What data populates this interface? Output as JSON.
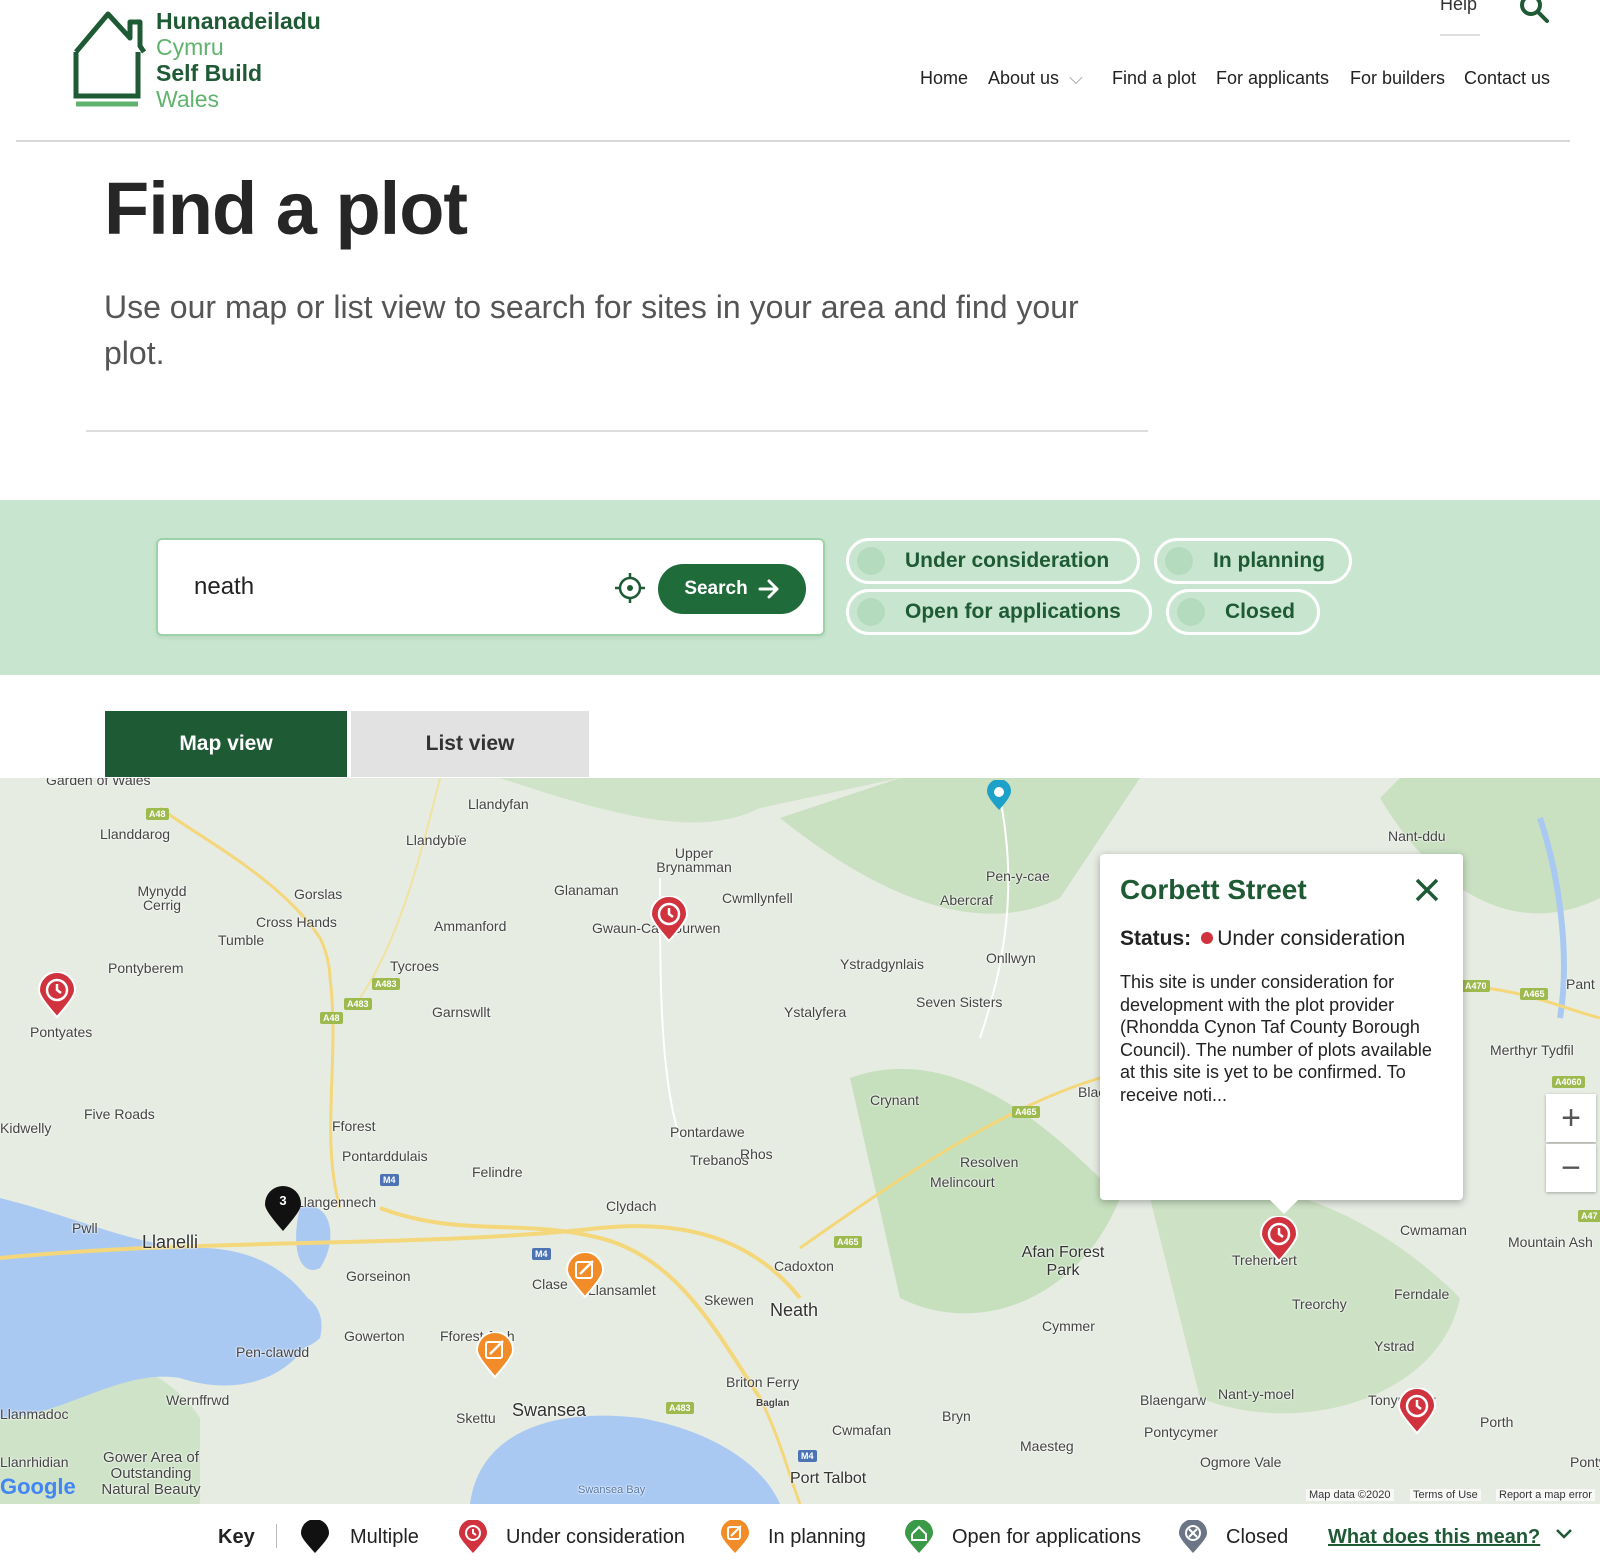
{
  "logo": {
    "line1": "Hunanadeiladu",
    "line2": "Cymru",
    "line3": "Self Build",
    "line4": "Wales"
  },
  "header": {
    "help": "Help",
    "nav": [
      "Home",
      "About us",
      "Find a plot",
      "For applicants",
      "For builders",
      "Contact us"
    ]
  },
  "hero": {
    "title": "Find a plot",
    "lead": "Use our map or list view to search for sites in your area and find your plot."
  },
  "search": {
    "value": "neath",
    "button": "Search",
    "filters": [
      "Under consideration",
      "In planning",
      "Open for applications",
      "Closed"
    ]
  },
  "tabs": {
    "map": "Map view",
    "list": "List view"
  },
  "map": {
    "places": [
      "Garden of Wales",
      "Llandyfan",
      "Llanddarog",
      "Llandybïe",
      "Upper Brynamman",
      "Nant-ddu",
      "Mynydd Cerrig",
      "Gorslas",
      "Glanaman",
      "Cwmllynfell",
      "Pen-y-cae",
      "Cross Hands",
      "Abercraf",
      "Tumble",
      "Ammanford",
      "Gwaun-Cae-Gurwen",
      "Pontyberem",
      "Tycroes",
      "Ystradgynlais",
      "Onllwyn",
      "Garnswllt",
      "Seven Sisters",
      "Ystalyfera",
      "Pontyates",
      "Pant",
      "Merthyr Tydfil",
      "Crynant",
      "Blaengwrach",
      "Five Roads",
      "Fforest",
      "Pontardawe",
      "Kidwelly",
      "Pontarddulais",
      "Trebanos",
      "Rhos",
      "Resolven",
      "Felindre",
      "Melincourt",
      "Llangennech",
      "Clydach",
      "Pwll",
      "Llanelli",
      "Cwmaman",
      "Mountain Ash",
      "Cadoxton",
      "Afan Forest Park",
      "Gorseinon",
      "Clase",
      "Llansamlet",
      "Skewen",
      "Neath",
      "Treherbert",
      "Treorchy",
      "Ferndale",
      "Gowerton",
      "Fforest-fach",
      "Cymmer",
      "Pen-clawdd",
      "Ystrad",
      "Briton Ferry",
      "Wernffrwd",
      "Baglan",
      "Blaengarw",
      "Nant-y-moel",
      "Tonypandy",
      "Skettu",
      "Swansea",
      "Pontycymer",
      "Porth",
      "Cwmafan",
      "Bryn",
      "Maesteg",
      "Llanmadoc",
      "Gower Area of Outstanding Natural Beauty",
      "Port Talbot",
      "Ogmore Vale",
      "Swansea Bay",
      "Llanrhidian",
      "Ponty"
    ],
    "roads": [
      "A48",
      "A483",
      "A483",
      "A48",
      "M4",
      "M4",
      "A465",
      "A465",
      "A483",
      "M4",
      "A470",
      "A465",
      "A4060",
      "A47"
    ],
    "cluster_count": "3",
    "popup": {
      "title": "Corbett Street",
      "status_label": "Status:",
      "status_value": "Under consideration",
      "description": "This site is under consideration for development with the plot provider (Rhondda Cynon Taf County Borough Council). The number of plots available at this site is yet to be confirmed. To receive noti..."
    },
    "zoom_in": "+",
    "zoom_out": "−",
    "attribution": "Map data ©2020",
    "terms": "Terms of Use",
    "report": "Report a map error",
    "google": "Google"
  },
  "key": {
    "title": "Key",
    "items": [
      "Multiple",
      "Under consideration",
      "In planning",
      "Open for applications",
      "Closed"
    ],
    "what": "What does this mean?"
  },
  "colors": {
    "brand_dark": "#1e5a34",
    "brand_light": "#5fb36d",
    "band": "#c8e6cf",
    "under_consideration": "#d0323e",
    "in_planning": "#f28c28",
    "open": "#3a9a47",
    "closed": "#6b7585",
    "multiple": "#111111"
  },
  "icons": [
    "house-logo-icon",
    "search-icon",
    "chevron-down-icon",
    "crosshair-icon",
    "arrow-right-icon",
    "clock-marker-icon",
    "pencil-marker-icon",
    "home-marker-icon",
    "close-icon"
  ]
}
